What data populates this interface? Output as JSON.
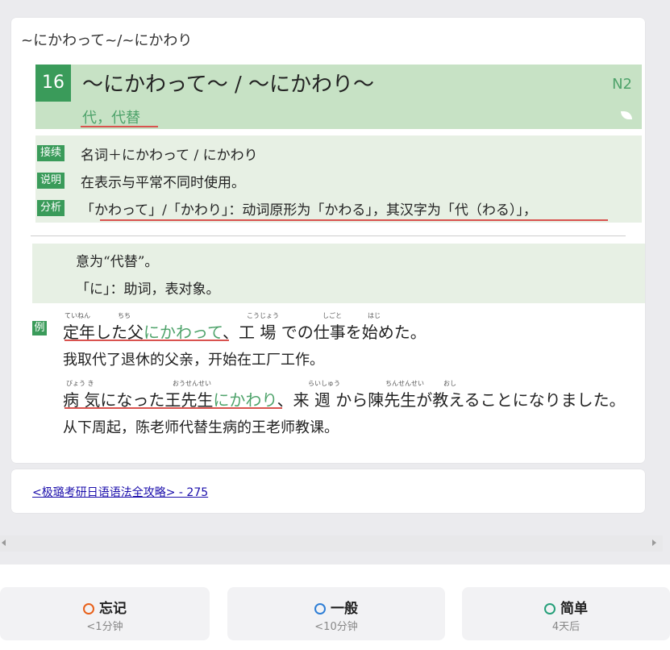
{
  "card": {
    "title": "~にかわって~/~にかわり",
    "header": {
      "number": "16",
      "grammar": "～にかわって～ / ～にかわり～",
      "level": "N2",
      "meaning": "代，代替"
    },
    "info": {
      "rows": [
        {
          "tag": "接续",
          "text": "名词＋にかわって / にかわり"
        },
        {
          "tag": "说明",
          "text": "在表示与平常不同时使用。"
        },
        {
          "tag": "分析",
          "text": "「かわって」/「かわり」：动词原形为「かわる」，其汉字为「代（わる）」，"
        }
      ]
    },
    "continuation": [
      "意为“代替”。",
      "「に」：助词，表对象。"
    ],
    "example_tag": "例",
    "examples": [
      {
        "jp_before": "定年した父",
        "jp_highlight": "にかわって",
        "jp_after": "、工 場 での仕事を始めた。",
        "furigana": [
          "ていねん",
          "ちち",
          "こうじょう",
          "しごと",
          "はじ"
        ],
        "cn": "我取代了退休的父亲，开始在工厂工作。"
      },
      {
        "jp_before": "病 気になった王先生",
        "jp_highlight": "にかわり",
        "jp_after": "、来 週 から陳先生が教えることになりました。",
        "furigana": [
          "びょう き",
          "おうせんせい",
          "らいしゅう",
          "ちんせんせい",
          "おし"
        ],
        "cn": "从下周起，陈老师代替生病的王老师教课。"
      }
    ]
  },
  "source": {
    "link": "<极璐考研日语语法全攻略> - 275"
  },
  "buttons": [
    {
      "label": "忘记",
      "sub": "<1分钟",
      "color": "#e8611a"
    },
    {
      "label": "一般",
      "sub": "<10分钟",
      "color": "#2f7fd6"
    },
    {
      "label": "简单",
      "sub": "4天后",
      "color": "#27a07a"
    }
  ]
}
